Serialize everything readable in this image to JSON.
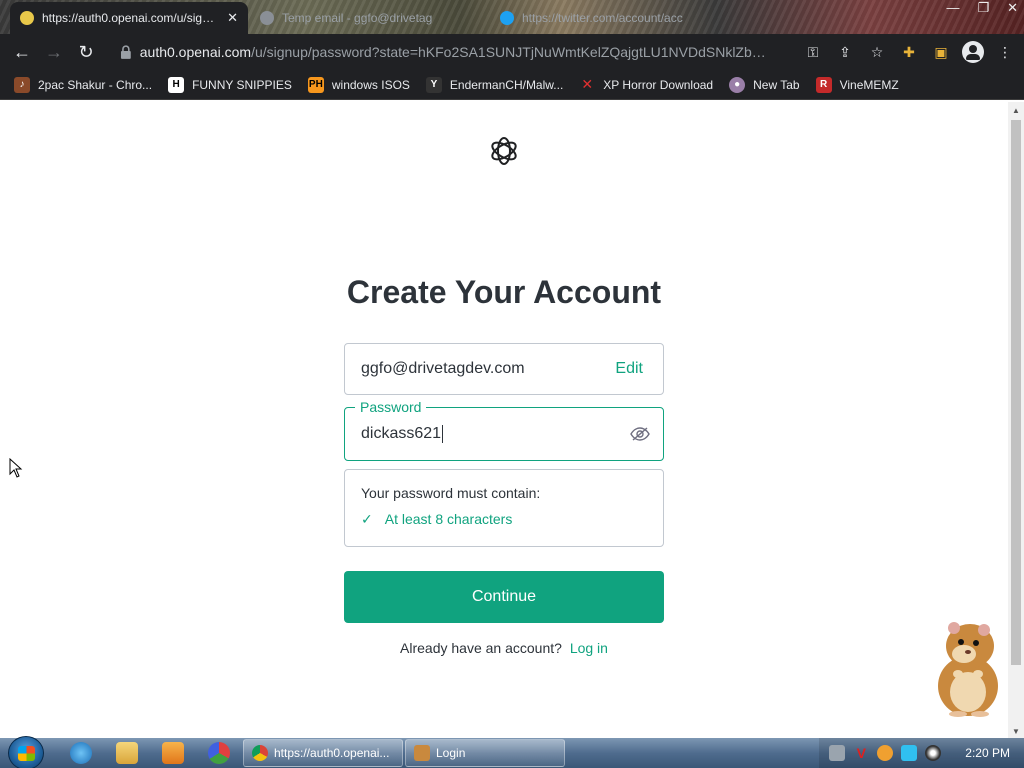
{
  "browser": {
    "tabs": [
      {
        "title": "https://auth0.openai.com/u/signup",
        "active": true,
        "icon": "auth0-favicon"
      },
      {
        "title": "Temp email - ggfo@drivetag",
        "active": false,
        "icon": "globe-favicon"
      },
      {
        "title": "https://twitter.com/account/acc",
        "active": false,
        "icon": "twitter-favicon"
      }
    ],
    "url_host": "auth0.openai.com",
    "url_path": "/u/signup/password?state=hKFo2SA1SUNJTjNuWmtKelZQajgtLU1NVDdSNklZbXlfa...",
    "bookmarks": [
      {
        "label": "2pac Shakur - Chro...",
        "icon": "bookmark-icon-2pac"
      },
      {
        "label": "FUNNY SNIPPIES",
        "icon": "bookmark-icon-h"
      },
      {
        "label": "windows ISOS",
        "icon": "bookmark-icon-ph"
      },
      {
        "label": "EndermanCH/Malw...",
        "icon": "bookmark-icon-y"
      },
      {
        "label": "XP Horror Download",
        "icon": "bookmark-icon-x"
      },
      {
        "label": "New Tab",
        "icon": "bookmark-icon-globe"
      },
      {
        "label": "VineMEMZ",
        "icon": "bookmark-icon-r"
      }
    ]
  },
  "signup": {
    "heading": "Create Your Account",
    "email_value": "ggfo@drivetagdev.com",
    "edit_label": "Edit",
    "password_label": "Password",
    "password_value": "dickass621",
    "requirements_title": "Your password must contain:",
    "requirement_check": "✓",
    "requirement_1": "At least 8 characters",
    "continue_label": "Continue",
    "login_prompt": "Already have an account?",
    "login_link": "Log in"
  },
  "taskbar": {
    "buttons": [
      {
        "label": "https://auth0.openai...",
        "icon": "chrome-icon"
      },
      {
        "label": "Login",
        "icon": "login-app-icon"
      }
    ],
    "clock": "2:20 PM"
  },
  "colors": {
    "accent": "#10a37f",
    "text": "#2d333a",
    "border": "#c2c8d0"
  }
}
